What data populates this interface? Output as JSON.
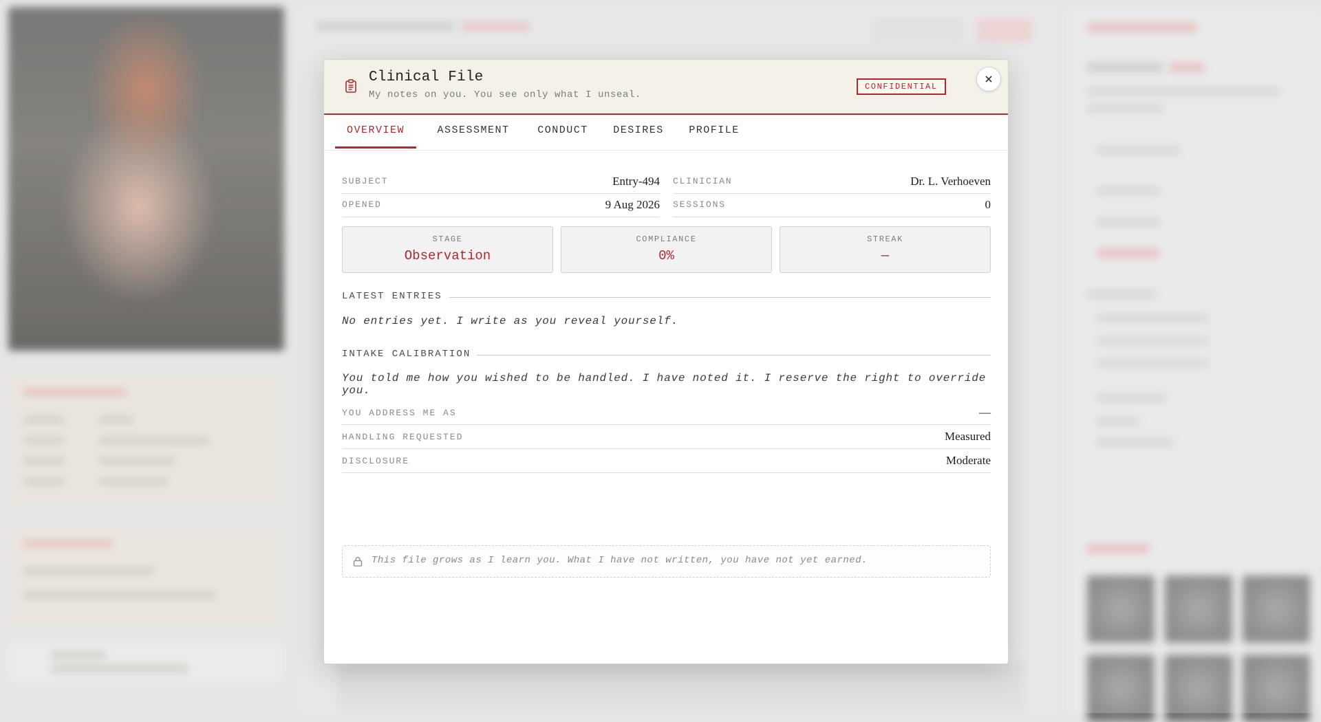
{
  "modal": {
    "title": "Clinical File",
    "subtitle": "My notes on you. You see only what I unseal.",
    "badge": "CONFIDENTIAL",
    "close_icon": "close-icon",
    "header_icon": "clipboard-icon",
    "accent_color": "#b3262b"
  },
  "tabs": [
    {
      "label": "OVERVIEW",
      "active": true
    },
    {
      "label": "ASSESSMENT",
      "active": false
    },
    {
      "label": "CONDUCT",
      "active": false
    },
    {
      "label": "DESIRES",
      "active": false
    },
    {
      "label": "PROFILE",
      "active": false
    }
  ],
  "overview": {
    "subject": {
      "label": "SUBJECT",
      "value": "Entry-494"
    },
    "clinician": {
      "label": "CLINICIAN",
      "value": "Dr. L. Verhoeven"
    },
    "opened": {
      "label": "OPENED",
      "value": "9 Aug 2026"
    },
    "sessions": {
      "label": "SESSIONS",
      "value": "0"
    },
    "stats": [
      {
        "label": "STAGE",
        "value": "Observation"
      },
      {
        "label": "COMPLIANCE",
        "value": "0%"
      },
      {
        "label": "STREAK",
        "value": "—"
      }
    ],
    "latest_entries": {
      "heading": "LATEST ENTRIES",
      "text": "No entries yet. I write as you reveal yourself."
    },
    "intake": {
      "heading": "INTAKE CALIBRATION",
      "text": "You told me how you wished to be handled. I have noted it. I reserve the right to override you.",
      "rows": [
        {
          "label": "YOU ADDRESS ME AS",
          "value": "—"
        },
        {
          "label": "HANDLING REQUESTED",
          "value": "Measured"
        },
        {
          "label": "DISCLOSURE",
          "value": "Moderate"
        }
      ]
    },
    "notice": {
      "icon": "lock-icon",
      "text": "This file grows as I learn you. What I have not written, you have not yet earned."
    }
  }
}
